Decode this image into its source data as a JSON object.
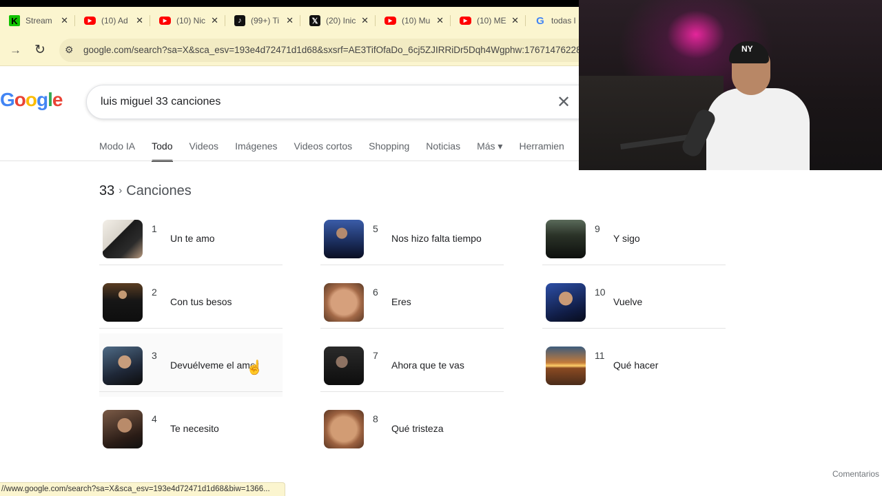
{
  "browser": {
    "tabs": [
      {
        "icon": "kick-icon",
        "glyph": "K",
        "title": "Stream"
      },
      {
        "icon": "youtube-icon",
        "glyph": "▶",
        "title": "(10) Ad"
      },
      {
        "icon": "youtube-icon",
        "glyph": "▶",
        "title": "(10) Nic"
      },
      {
        "icon": "tiktok-icon",
        "glyph": "♪",
        "title": "(99+) Ti"
      },
      {
        "icon": "x-icon",
        "glyph": "𝕏",
        "title": "(20) Inic"
      },
      {
        "icon": "youtube-icon",
        "glyph": "▶",
        "title": "(10) Mu"
      },
      {
        "icon": "youtube-icon",
        "glyph": "▶",
        "title": "(10) ME"
      },
      {
        "icon": "google-icon",
        "glyph": "G",
        "title": "todas l"
      }
    ],
    "close_glyph": "✕",
    "url": "google.com/search?sa=X&sca_esv=193e4d72471d1d68&sxsrf=AE3TifOfaDo_6cj5ZJIRRiDr5Dqh4Wgphw:17671476228"
  },
  "google": {
    "logo": "Google",
    "query": "luis miguel 33 canciones",
    "nav_tabs": [
      "Modo IA",
      "Todo",
      "Videos",
      "Imágenes",
      "Videos cortos",
      "Shopping",
      "Noticias",
      "Más",
      "Herramien"
    ],
    "active_tab": "Todo",
    "breadcrumb": {
      "first": "33",
      "separator": "›",
      "last": "Canciones"
    },
    "songs": [
      {
        "num": "1",
        "title": "Un te amo"
      },
      {
        "num": "2",
        "title": "Con tus besos"
      },
      {
        "num": "3",
        "title": "Devuélveme el amor"
      },
      {
        "num": "4",
        "title": "Te necesito"
      },
      {
        "num": "5",
        "title": "Nos hizo falta tiempo"
      },
      {
        "num": "6",
        "title": "Eres"
      },
      {
        "num": "7",
        "title": "Ahora que te vas"
      },
      {
        "num": "8",
        "title": "Qué tristeza"
      },
      {
        "num": "9",
        "title": "Y sigo"
      },
      {
        "num": "10",
        "title": "Vuelve"
      },
      {
        "num": "11",
        "title": "Qué hacer"
      }
    ],
    "feedback": "Comentarios"
  },
  "status_url": "//www.google.com/search?sa=X&sca_esv=193e4d72471d1d68&biw=1366...",
  "colors": {
    "tab_bar": "#fbf5cf",
    "active_tab_underline": "#1f1f1f"
  }
}
